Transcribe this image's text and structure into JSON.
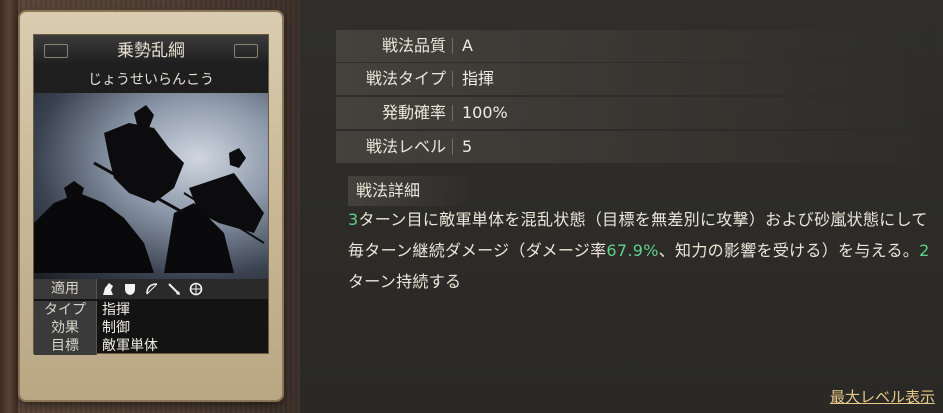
{
  "card": {
    "name": "乗勢乱綱",
    "reading": "じょうせいらんこう",
    "applicable_label": "適用",
    "applicable_icons": [
      "cavalry-icon",
      "shield-icon",
      "bow-icon",
      "spear-icon",
      "siege-icon"
    ],
    "stats": [
      {
        "label": "タイプ",
        "value": "指揮"
      },
      {
        "label": "効果",
        "value": "制御"
      },
      {
        "label": "目標",
        "value": "敵軍単体"
      }
    ]
  },
  "info": [
    {
      "label": "戦法品質",
      "value": "A"
    },
    {
      "label": "戦法タイプ",
      "value": "指揮"
    },
    {
      "label": "発動確率",
      "value": "100%"
    },
    {
      "label": "戦法レベル",
      "value": "5"
    }
  ],
  "detail": {
    "heading": "戦法詳細",
    "seg1": "3",
    "seg2": "ターン目に敵軍単体を混乱状態（目標を無差別に攻撃）および砂嵐状態にして毎ターン継続ダメージ（ダメージ率",
    "seg3": "67.9%",
    "seg4": "、知力の影響を受ける）を与える。",
    "seg5": "2",
    "seg6": "ターン持続する"
  },
  "max_level_link": "最大レベル表示",
  "colors": {
    "highlight": "#5fd08a",
    "link": "#e6c98a"
  }
}
